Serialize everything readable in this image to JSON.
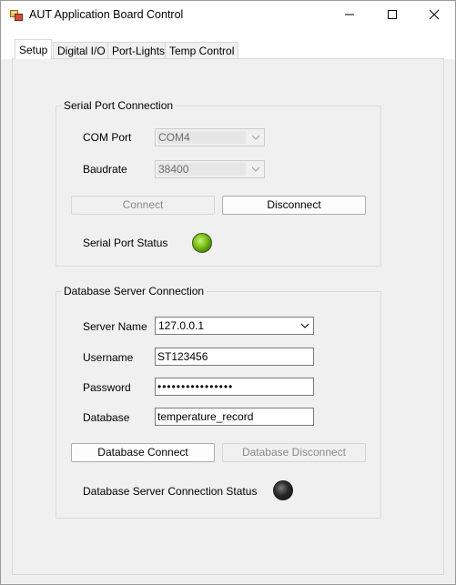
{
  "window": {
    "title": "AUT Application Board Control"
  },
  "tabs": [
    {
      "label": "Setup"
    },
    {
      "label": "Digital I/O"
    },
    {
      "label": "Port-Lights"
    },
    {
      "label": "Temp Control"
    }
  ],
  "serial": {
    "group_title": "Serial Port Connection",
    "com_label": "COM Port",
    "com_value": "COM4",
    "baud_label": "Baudrate",
    "baud_value": "38400",
    "connect_label": "Connect",
    "disconnect_label": "Disconnect",
    "status_label": "Serial Port Status",
    "status_color": "#7fc21a"
  },
  "database": {
    "group_title": "Database Server Connection",
    "server_label": "Server Name",
    "server_value": "127.0.0.1",
    "username_label": "Username",
    "username_value": "ST123456",
    "password_label": "Password",
    "password_value": "••••••••••••••••",
    "database_label": "Database",
    "database_value": "temperature_record",
    "connect_label": "Database Connect",
    "disconnect_label": "Database Disconnect",
    "status_label": "Database Server Connection Status",
    "status_color": "#111111"
  }
}
